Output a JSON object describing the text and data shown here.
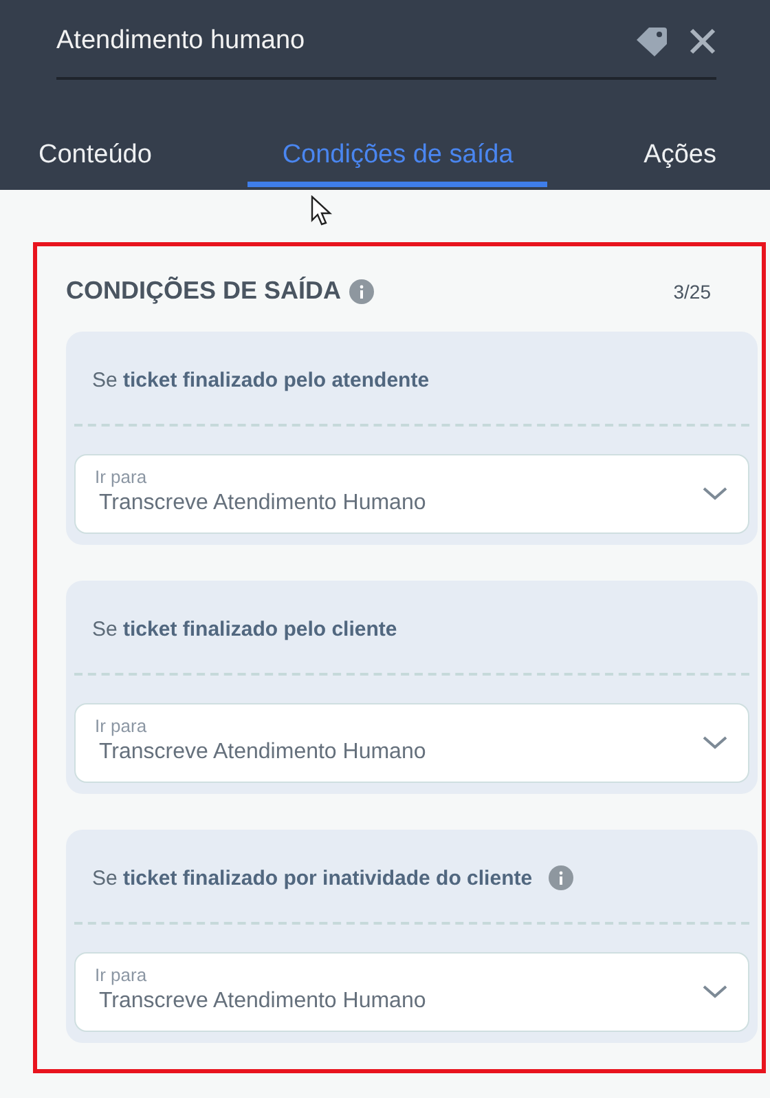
{
  "header": {
    "title": "Atendimento humano"
  },
  "tabs": [
    {
      "label": "Conteúdo",
      "selected": false
    },
    {
      "label": "Condições de saída",
      "selected": true
    },
    {
      "label": "Ações",
      "selected": false
    }
  ],
  "section": {
    "title": "CONDIÇÕES DE SAÍDA",
    "count": "3/25",
    "highlighted": true
  },
  "conditions": [
    {
      "text": "Se **ticket finalizado pelo atendente**",
      "info": false,
      "field_label": "Ir para",
      "value": "Transcreve Atendimento Humano"
    },
    {
      "text": "Se **ticket finalizado pelo cliente**",
      "info": false,
      "field_label": "Ir para",
      "value": "Transcreve Atendimento Humano"
    },
    {
      "text": "Se **ticket finalizado por inatividade do cliente**",
      "info": true,
      "field_label": "Ir para",
      "value": "Transcreve Atendimento Humano"
    }
  ]
}
